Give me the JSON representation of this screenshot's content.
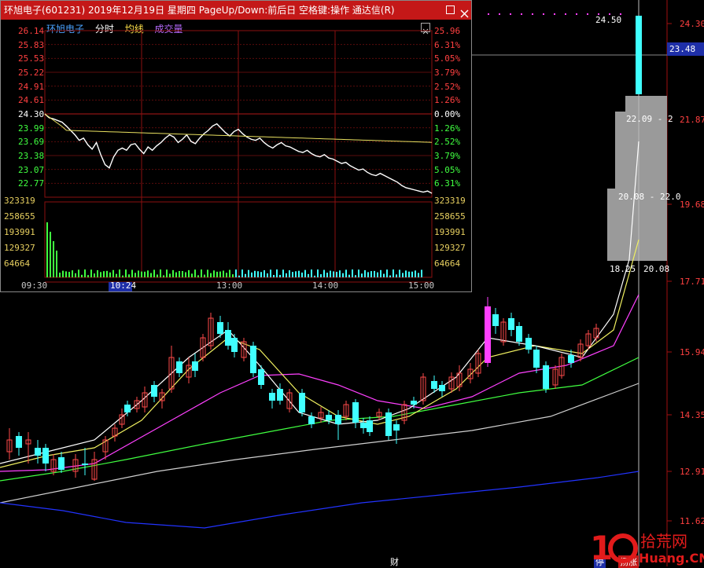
{
  "window": {
    "title": "环旭电子(601231) 2019年12月19日 星期四 PageUp/Down:前后日 空格键:操作 通达信(R)",
    "tabs": [
      "环旭电子",
      "分时",
      "均线",
      "成交量"
    ],
    "price_labels": [
      "26.14",
      "25.83",
      "25.53",
      "25.22",
      "24.91",
      "24.61",
      "24.30",
      "23.99",
      "23.69",
      "23.38",
      "23.07",
      "22.77"
    ],
    "pct_labels": [
      "25.96",
      "6.31%",
      "5.05%",
      "3.79%",
      "2.52%",
      "1.26%",
      "0.00%",
      "1.26%",
      "2.52%",
      "3.79%",
      "5.05%",
      "6.31%"
    ],
    "volume_labels": [
      "323319",
      "258655",
      "193991",
      "129327",
      "64664"
    ],
    "time_labels": [
      "09:30",
      "10:24",
      "13:00",
      "14:00",
      "15:00"
    ],
    "intraday": [
      0,
      -0.35,
      -0.45,
      -0.6,
      -0.75,
      -1.1,
      -1.5,
      -1.9,
      -2.4,
      -2.2,
      -2.8,
      -3.2,
      -2.6,
      -3.7,
      -4.6,
      -4.9,
      -3.9,
      -3.3,
      -3.1,
      -3.3,
      -2.8,
      -2.7,
      -3.2,
      -3.6,
      -3.0,
      -3.3,
      -2.9,
      -2.6,
      -2.2,
      -1.9,
      -2.1,
      -2.6,
      -2.3,
      -1.9,
      -2.5,
      -2.7,
      -2.2,
      -1.8,
      -1.5,
      -1.1,
      -0.9,
      -1.3,
      -1.7,
      -2.0,
      -1.6,
      -1.4,
      -1.8,
      -2.1,
      -2.3,
      -2.4,
      -2.2,
      -2.6,
      -2.9,
      -3.1,
      -2.8,
      -2.6,
      -2.9,
      -3.0,
      -3.2,
      -3.4,
      -3.5,
      -3.3,
      -3.6,
      -3.8,
      -3.9,
      -3.7,
      -4.0,
      -4.1,
      -4.3,
      -4.5,
      -4.4,
      -4.7,
      -4.9,
      -5.1,
      -5.0,
      -5.3,
      -5.5,
      -5.6,
      -5.4,
      -5.6,
      -5.8,
      -6.0,
      -6.2,
      -6.5,
      -6.7,
      -6.8,
      -6.9,
      -7.0,
      -7.1,
      -7.0,
      -7.2
    ]
  },
  "chart": {
    "price_axis": [
      "24.30",
      "21.87",
      "19.68",
      "17.71",
      "15.94",
      "14.35",
      "12.91",
      "11.62"
    ],
    "current_price": "23.48",
    "high_label": "24.50",
    "depth_labels": [
      "22.09 - 2",
      "20.08 - 22.0",
      "18.25",
      "20.08"
    ],
    "bottom_marks": [
      "财",
      "停",
      "扬涨"
    ],
    "watermark": "10 拾荒网 Huang.CN"
  }
}
